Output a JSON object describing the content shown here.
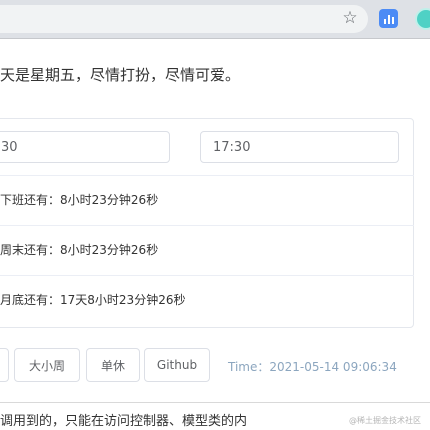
{
  "browser": {
    "bookmark_icon": "star-icon",
    "extensions": [
      "bar-chart-icon",
      "circle-extension-icon"
    ],
    "accent": "#4c8bf5"
  },
  "greeting": "天是星期五，尽情打扮，尽情可爱。",
  "inputs": {
    "start_time": "30",
    "end_time": "17:30"
  },
  "countdowns": [
    {
      "label": "下班还有：",
      "value": "8小时23分钟26秒"
    },
    {
      "label": "周末还有：",
      "value": "8小时23分钟26秒"
    },
    {
      "label": "月底还有：",
      "value": "17天8小时23分钟26秒"
    }
  ],
  "buttons": {
    "week_label": "大小周",
    "single_label": "单休",
    "github_label": "Github"
  },
  "time_label": "Time：",
  "time_value": "2021-05-14 09:06:34",
  "bottom_text": "调用到的，只能在访问控制器、模型类的内",
  "watermark": "@稀土掘金技术社区"
}
